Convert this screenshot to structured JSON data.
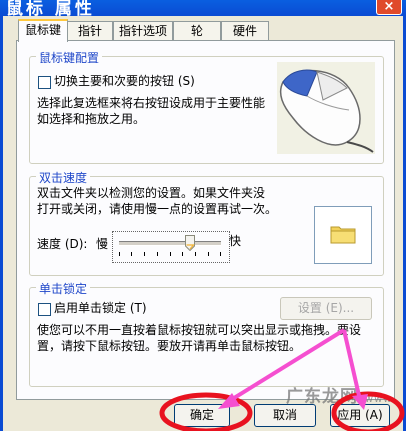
{
  "window": {
    "title": "鼠标 属性",
    "close_label": "×"
  },
  "tabs": [
    {
      "label": "鼠标键"
    },
    {
      "label": "指针"
    },
    {
      "label": "指针选项"
    },
    {
      "label": "轮"
    },
    {
      "label": "硬件"
    }
  ],
  "button_config": {
    "title": "鼠标键配置",
    "swap_label": "切换主要和次要的按钮 (S)",
    "swap_checked": false,
    "desc_line1": "选择此复选框来将右按钮设成用于主要性能",
    "desc_line2": "如选择和拖放之用。"
  },
  "double_click": {
    "title": "双击速度",
    "desc_line1": "双击文件夹以检测您的设置。如果文件夹没",
    "desc_line2": "打开或关闭，请使用慢一点的设置再试一次。",
    "speed_label": "速度 (D):",
    "slow_label": "慢",
    "fast_label": "快",
    "slider_value": 0.7
  },
  "click_lock": {
    "title": "单击锁定",
    "enable_label": "启用单击锁定 (T)",
    "enable_checked": false,
    "settings_label": "设置 (E)...",
    "desc_line1": "使您可以不用一直按着鼠标按钮就可以突出显示或拖拽。要设",
    "desc_line2": "置，请按下鼠标按钮。要放开请再单击鼠标按钮。"
  },
  "footer": {
    "ok_label": "确定",
    "cancel_label": "取消",
    "apply_label": "应用 (A)"
  },
  "watermark": {
    "text": "广东龙网",
    "suffix": "www"
  },
  "colors": {
    "annotation": "#E8121F",
    "arrow": "#F54FD0",
    "group_title": "#1F47C9",
    "titlebar": "#0A4BD3"
  }
}
